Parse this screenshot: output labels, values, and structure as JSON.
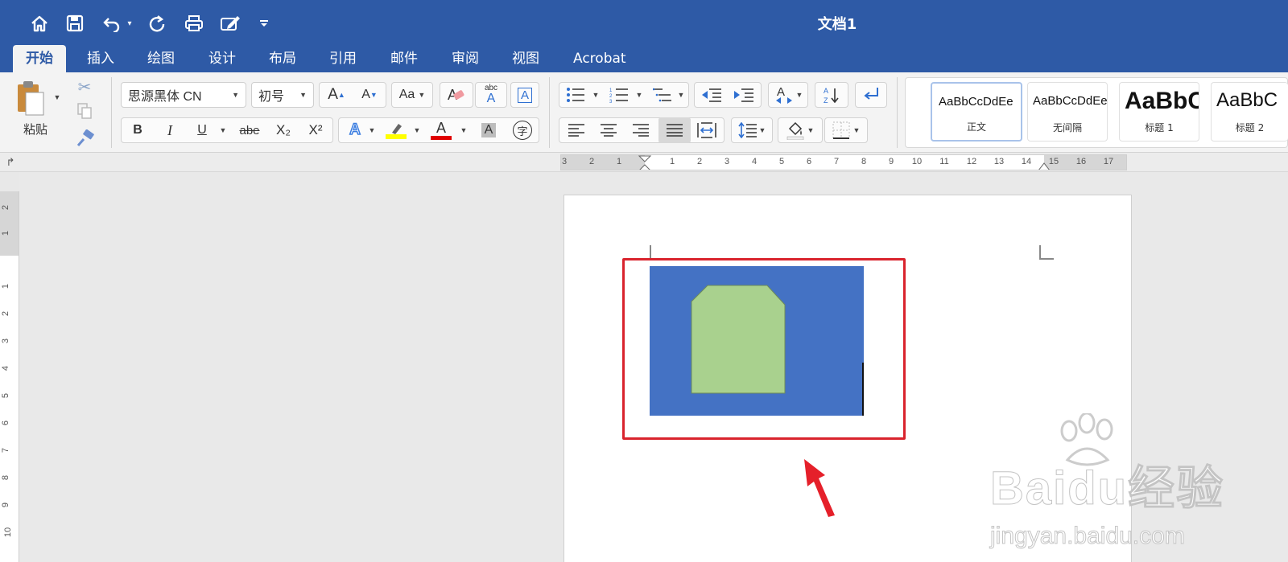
{
  "app": {
    "title": "文档1"
  },
  "quick_access": [
    {
      "name": "home-icon",
      "glyph": "⌂"
    },
    {
      "name": "save-icon",
      "glyph": "💾"
    },
    {
      "name": "undo-icon",
      "glyph": "↶"
    },
    {
      "name": "redo-icon",
      "glyph": "↺"
    },
    {
      "name": "print-icon",
      "glyph": "⎙"
    },
    {
      "name": "edit-icon",
      "glyph": "✎"
    },
    {
      "name": "customize-icon",
      "glyph": "⌄"
    }
  ],
  "tabs": [
    {
      "label": "开始",
      "active": true
    },
    {
      "label": "插入"
    },
    {
      "label": "绘图"
    },
    {
      "label": "设计"
    },
    {
      "label": "布局"
    },
    {
      "label": "引用"
    },
    {
      "label": "邮件"
    },
    {
      "label": "审阅"
    },
    {
      "label": "视图"
    },
    {
      "label": "Acrobat"
    }
  ],
  "ribbon": {
    "paste_label": "粘贴",
    "font_name": "思源黑体 CN",
    "font_size": "初号",
    "bold": "B",
    "italic": "I",
    "underline": "U",
    "strikethrough": "abe",
    "subscript": "X₂",
    "superscript": "X²",
    "grow_font": "A",
    "shrink_font": "A",
    "change_case": "Aa",
    "clear_format": "A",
    "phonetic_top": "abc",
    "phonetic_bottom": "A",
    "char_border": "A",
    "text_effect": "A",
    "font_color": "A",
    "char_shading": "A",
    "enclose_char": "字"
  },
  "styles": [
    {
      "sample": "AaBbCcDdEe",
      "name": "正文",
      "selected": true
    },
    {
      "sample": "AaBbCcDdEe",
      "name": "无间隔"
    },
    {
      "sample": "AaBbC",
      "name": "标题 1"
    },
    {
      "sample": "AaBbC",
      "name": "标题 2"
    }
  ],
  "ruler": {
    "labels": [
      "3",
      "2",
      "1",
      "",
      "1",
      "2",
      "3",
      "4",
      "5",
      "6",
      "7",
      "8",
      "9",
      "10",
      "11",
      "12",
      "13",
      "14",
      "15",
      "16",
      "17"
    ],
    "vertical_labels": [
      "2",
      "1",
      "1",
      "2",
      "3",
      "4",
      "5",
      "6",
      "7",
      "8",
      "9",
      "10"
    ]
  },
  "document": {
    "shape_fill_outer": "#4472c4",
    "shape_fill_inner": "#a9d18e",
    "highlight_color": "#d9232d"
  },
  "watermark": {
    "logo_text": "Baidu经验",
    "url": "jingyan.baidu.com"
  },
  "colors": {
    "title_bar": "#2e5aa6",
    "ribbon_bg": "#f3f3f3",
    "highlight_yellow": "#ffff00",
    "font_red": "#e00000"
  }
}
